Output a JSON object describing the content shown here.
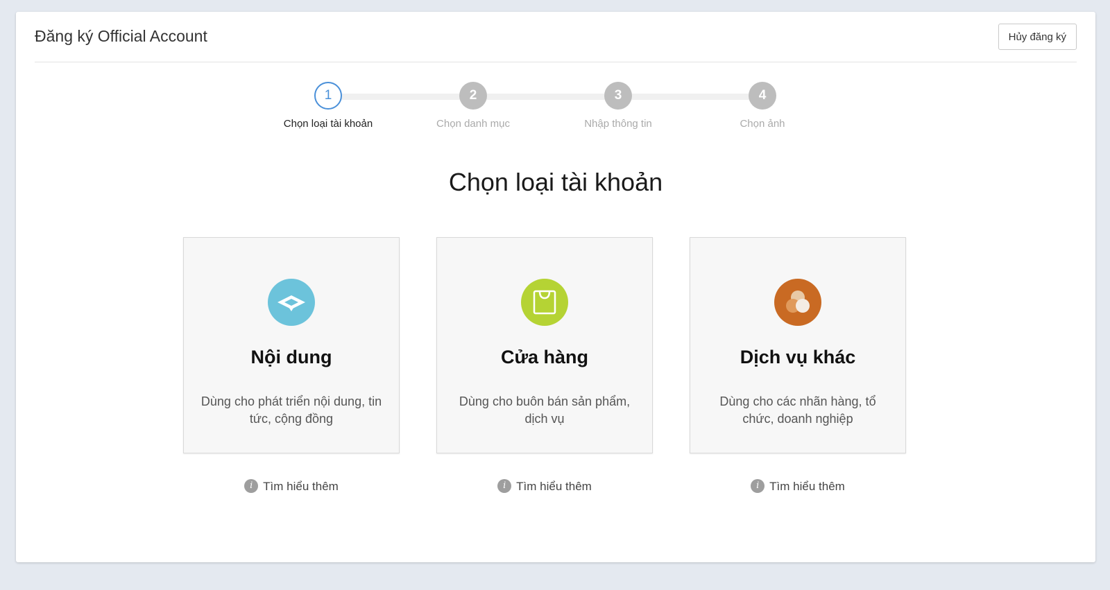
{
  "header": {
    "title": "Đăng ký Official Account",
    "cancel_label": "Hủy đăng ký"
  },
  "stepper": {
    "steps": [
      {
        "number": "1",
        "label": "Chọn loại tài khoản",
        "active": true
      },
      {
        "number": "2",
        "label": "Chọn danh mục",
        "active": false
      },
      {
        "number": "3",
        "label": "Nhập thông tin",
        "active": false
      },
      {
        "number": "4",
        "label": "Chọn ảnh",
        "active": false
      }
    ]
  },
  "main": {
    "heading": "Chọn loại tài khoản",
    "cards": [
      {
        "title": "Nội dung",
        "description": "Dùng cho phát triển nội dung, tin tức, cộng đồng",
        "icon": "chat-bubble-icon",
        "icon_color": "#6cc3db",
        "learn_more": "Tìm hiểu thêm"
      },
      {
        "title": "Cửa hàng",
        "description": "Dùng cho buôn bán sản phẩm, dịch vụ",
        "icon": "shopping-bag-icon",
        "icon_color": "#b5d334",
        "learn_more": "Tìm hiểu thêm"
      },
      {
        "title": "Dịch vụ khác",
        "description": "Dùng cho các nhãn hàng, tổ chức, doanh nghiệp",
        "icon": "circles-icon",
        "icon_color": "#c96a23",
        "learn_more": "Tìm hiểu thêm"
      }
    ]
  },
  "colors": {
    "accent": "#4a90d9",
    "background": "#e4e9f0",
    "step_inactive": "#bdbdbd"
  }
}
